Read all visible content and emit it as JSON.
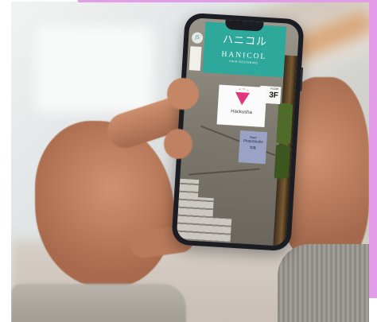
{
  "image": {
    "accent_color": "#e49bea",
    "skin_color": "#bd8060",
    "phone_color": "#1b1d22"
  },
  "phone_screen": {
    "top_sign": {
      "script_text": "ハニコル",
      "name": "HANICOL",
      "subtitle": "HAIR DESIGNING",
      "background": "#2ea89a"
    },
    "side_badge": "JS",
    "floor_sign": {
      "small": "FLOOR",
      "big": "3F"
    },
    "hack_sign": {
      "label": "Hackusha",
      "logo_color": "#e1367b"
    },
    "studio_sign": {
      "line1": "Noor",
      "line2": "PhotoStudio",
      "line3": "写真"
    }
  }
}
